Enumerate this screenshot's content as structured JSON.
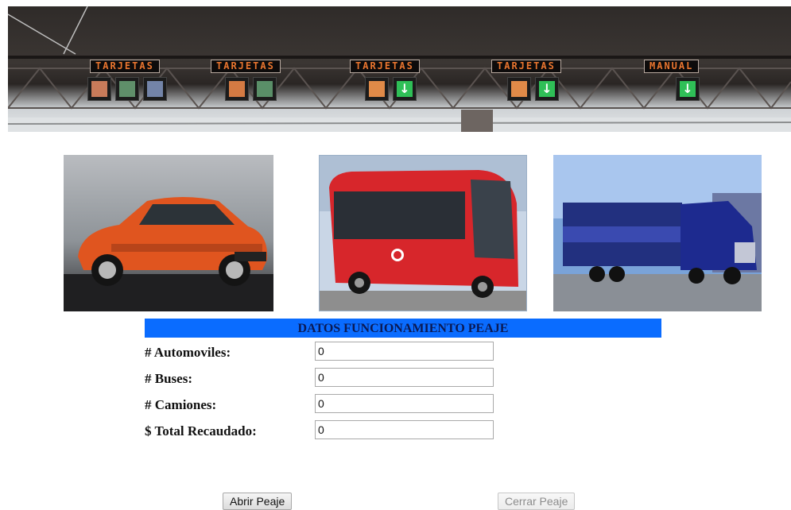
{
  "banner": {
    "signs": [
      "TARJETAS",
      "TARJETAS",
      "TARJETAS",
      "TARJETAS",
      "MANUAL"
    ],
    "arrow_glyph": "↓",
    "colors": {
      "sign_text": "#e9752f",
      "arrow_lamp": "#2fbf57",
      "amber_lamp": "#d47a43"
    }
  },
  "vehicles": [
    {
      "name": "automovil",
      "color": "#e0551f"
    },
    {
      "name": "bus",
      "color": "#d7262b"
    },
    {
      "name": "camion",
      "color": "#1d2a8f"
    }
  ],
  "form": {
    "title": "DATOS FUNCIONAMIENTO PEAJE",
    "fields": [
      {
        "label": "# Automoviles:",
        "value": "0"
      },
      {
        "label": "# Buses:",
        "value": "0"
      },
      {
        "label": "# Camiones:",
        "value": "0"
      },
      {
        "label": "$ Total Recaudado:",
        "value": "0"
      }
    ],
    "title_bg": "#0a6cff"
  },
  "buttons": {
    "open": "Abrir Peaje",
    "close": "Cerrar Peaje"
  }
}
